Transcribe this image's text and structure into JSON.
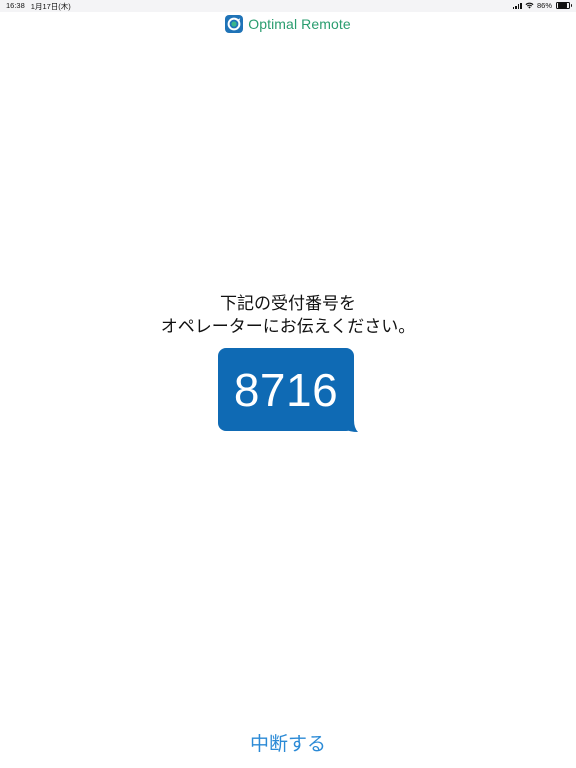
{
  "status_bar": {
    "time": "16:38",
    "date": "1月17日(木)",
    "battery": "86%",
    "battery_level": 0.86
  },
  "header": {
    "app_name": "Optimal Remote",
    "logo_icon": "optimal-remote-logo",
    "brand_color": "#1f73b7",
    "name_color": "#2a9d6f"
  },
  "main": {
    "instruction_line1": "下記の受付番号を",
    "instruction_line2": "オペレーターにお伝えください。",
    "reception_number": "8716",
    "bubble_color": "#0f6ab4"
  },
  "footer": {
    "cancel_label": "中断する",
    "link_color": "#2b8ad6"
  }
}
